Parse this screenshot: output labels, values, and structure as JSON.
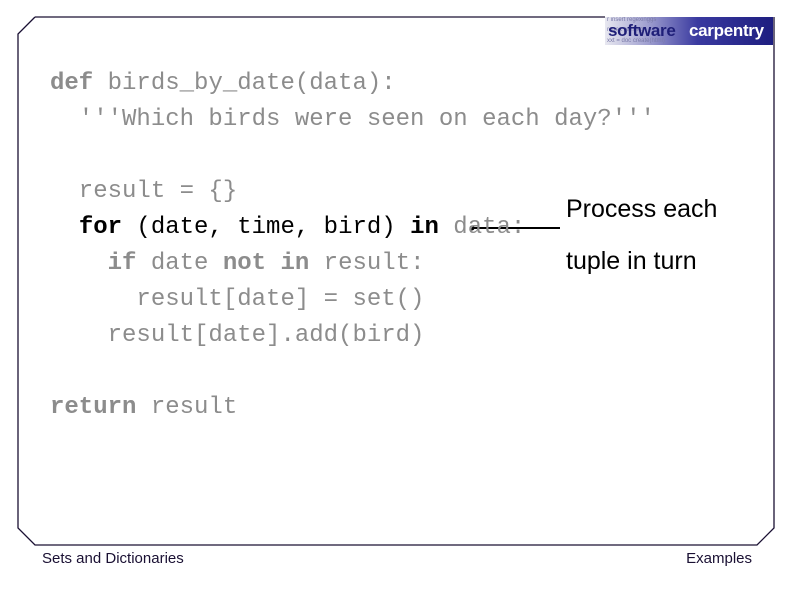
{
  "logo": {
    "word1": "software",
    "word2": "carpentry",
    "bg_lines": [
      "r insert regexinggs",
      "regex parsing",
      "xxt = doc create(html)"
    ]
  },
  "code": {
    "lines": [
      [
        {
          "t": "def",
          "kw": true
        },
        {
          "t": " birds_by_date(data):"
        }
      ],
      [
        {
          "t": "  '''Which birds were seen on each day?'''"
        }
      ],
      [],
      [
        {
          "t": "  result = {}"
        }
      ],
      [
        {
          "t": "  "
        },
        {
          "t": "for",
          "kw": true,
          "dark": true
        },
        {
          "t": " (date, time, bird) ",
          "dark": true
        },
        {
          "t": "in",
          "kw": true,
          "dark": true
        },
        {
          "t": " data:"
        }
      ],
      [
        {
          "t": "    "
        },
        {
          "t": "if",
          "kw": true
        },
        {
          "t": " date "
        },
        {
          "t": "not",
          "kw": true
        },
        {
          "t": " "
        },
        {
          "t": "in",
          "kw": true
        },
        {
          "t": " result:"
        }
      ],
      [
        {
          "t": "      result[date] = set()"
        }
      ],
      [
        {
          "t": "    result[date].add(bird)"
        }
      ],
      [],
      [
        {
          "t": "return",
          "kw": true
        },
        {
          "t": " result"
        }
      ]
    ]
  },
  "callout": {
    "line1": "Process each",
    "line2": "tuple in turn"
  },
  "footer": {
    "left": "Sets and Dictionaries",
    "right": "Examples"
  },
  "colors": {
    "frame": "#1a1033",
    "code_gray": "#8c8c8c",
    "highlight": "#000000"
  }
}
